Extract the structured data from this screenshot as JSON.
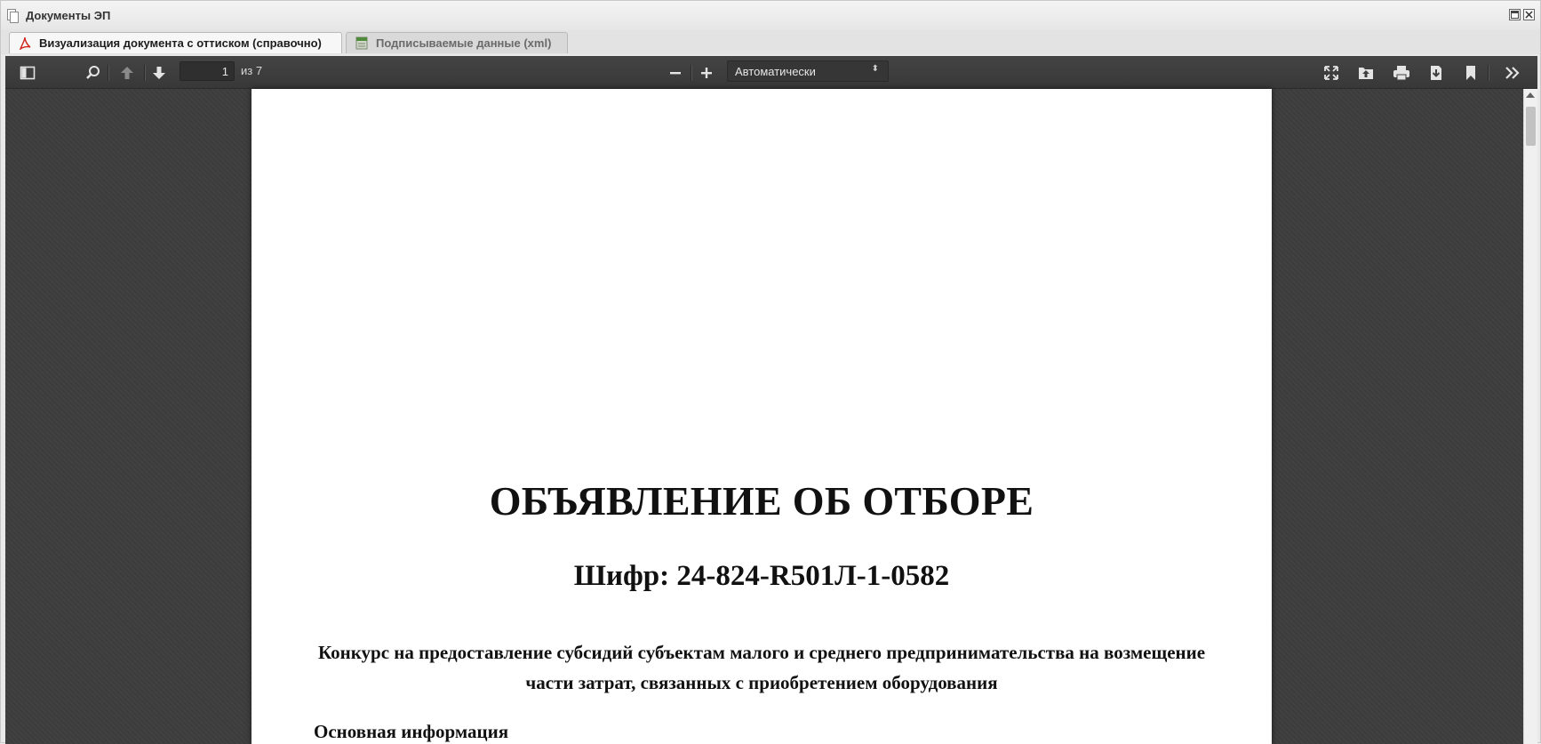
{
  "window": {
    "title": "Документы ЭП"
  },
  "tabs": [
    {
      "label": "Визуализация документа с оттиском (справочно)",
      "active": true,
      "icon": "pdf-icon"
    },
    {
      "label": "Подписываемые данные (xml)",
      "active": false,
      "icon": "xml-file-icon"
    }
  ],
  "toolbar": {
    "page_number": "1",
    "page_total": "из 7",
    "zoom_value": "Автоматически"
  },
  "document": {
    "title": "ОБЪЯВЛЕНИЕ ОБ ОТБОРЕ",
    "code": "Шифр: 24-824-R501Л-1-0582",
    "description": "Конкурс на предоставление субсидий субъектам малого и среднего предпринимательства на возмещение части затрат, связанных с приобретением оборудования",
    "section_heading": "Основная информация"
  },
  "colors": {
    "viewer_bg": "#404040",
    "toolbar_bg": "#3a3a3a",
    "pdf_red": "#d0241c"
  }
}
